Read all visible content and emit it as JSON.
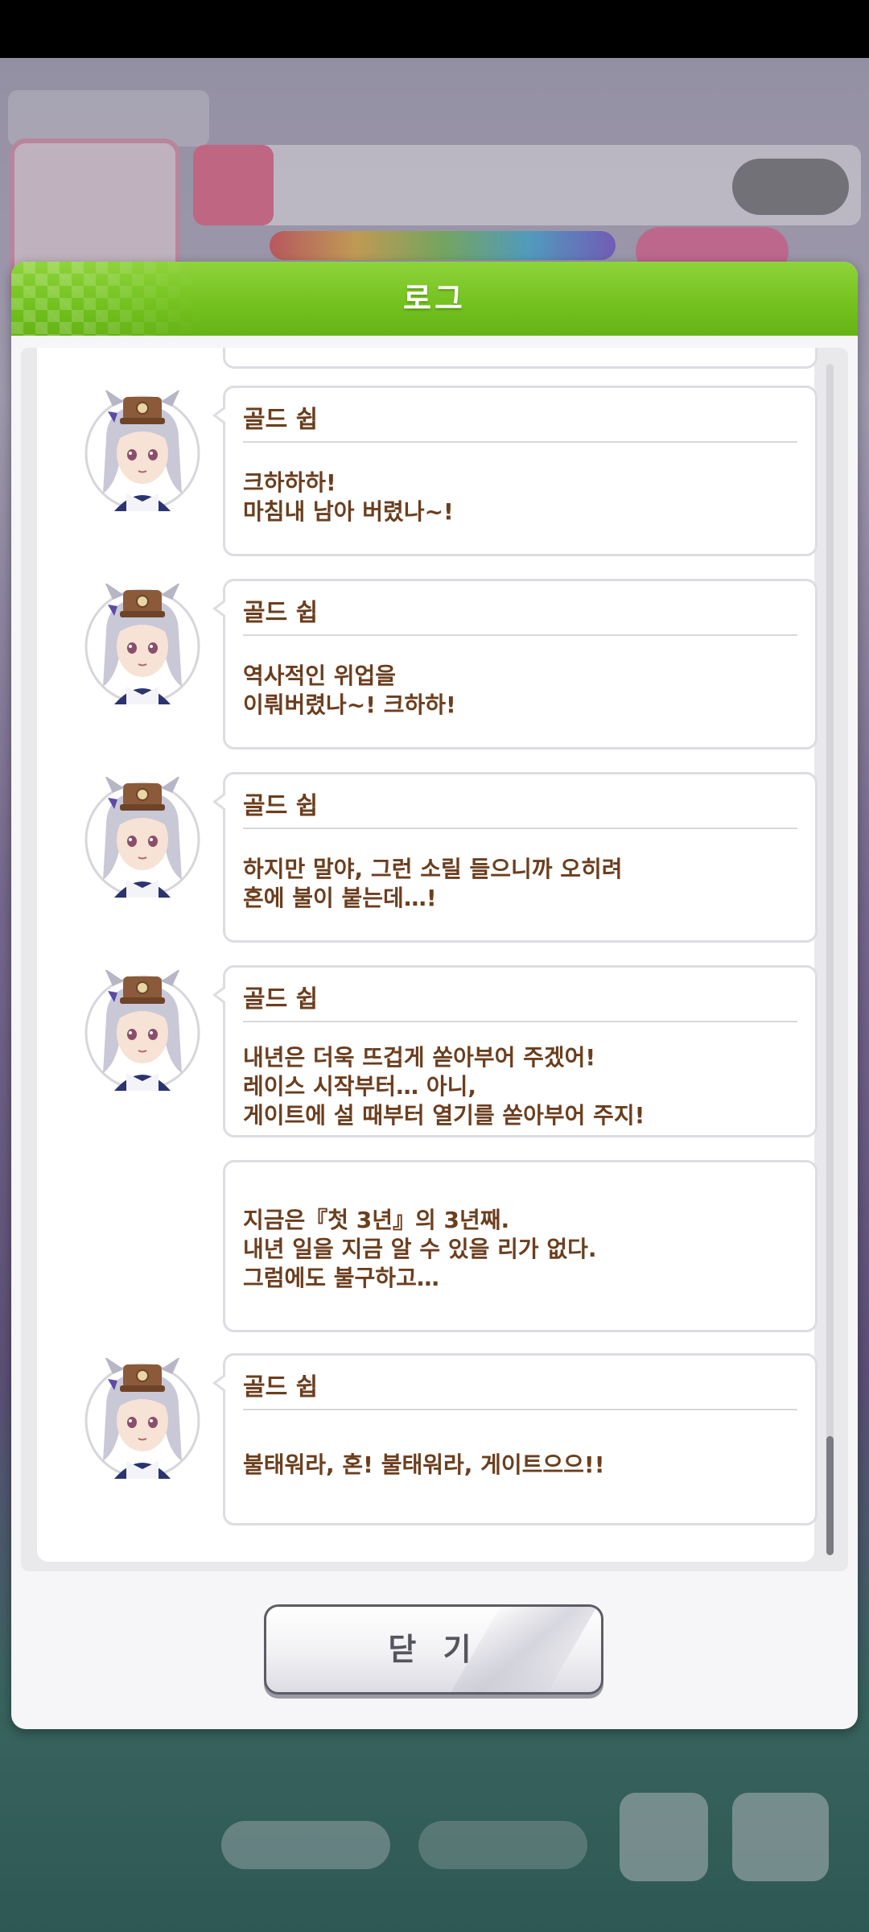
{
  "dialog": {
    "title": "로그",
    "close_label": "닫 기"
  },
  "entries": [
    {
      "speaker": "골드 쉽",
      "has_avatar": true,
      "text": "크하하하!\n마침내 남아 버렸나~!"
    },
    {
      "speaker": "골드 쉽",
      "has_avatar": true,
      "text": "역사적인 위업을\n이뤄버렸나~! 크하하!"
    },
    {
      "speaker": "골드 쉽",
      "has_avatar": true,
      "text": "하지만 말야, 그런 소릴 들으니까 오히려\n혼에 불이 붙는데…!"
    },
    {
      "speaker": "골드 쉽",
      "has_avatar": true,
      "text": "내년은 더욱 뜨겁게 쏟아부어 주겠어!\n레이스 시작부터… 아니,\n게이트에 설 때부터 열기를 쏟아부어 주지!"
    },
    {
      "speaker": "",
      "has_avatar": false,
      "text": "지금은『첫 3년』의 3년째.\n내년 일을 지금 알 수 있을 리가 없다.\n그럼에도 불구하고…"
    },
    {
      "speaker": "골드 쉽",
      "has_avatar": true,
      "text": "불태워라, 혼! 불태워라, 게이트으으!!"
    }
  ],
  "scroll": {
    "position": 1.0
  },
  "colors": {
    "header_green": "#72c11d",
    "text_brown": "#6b3e1e",
    "bubble_border": "#dcdce2"
  }
}
